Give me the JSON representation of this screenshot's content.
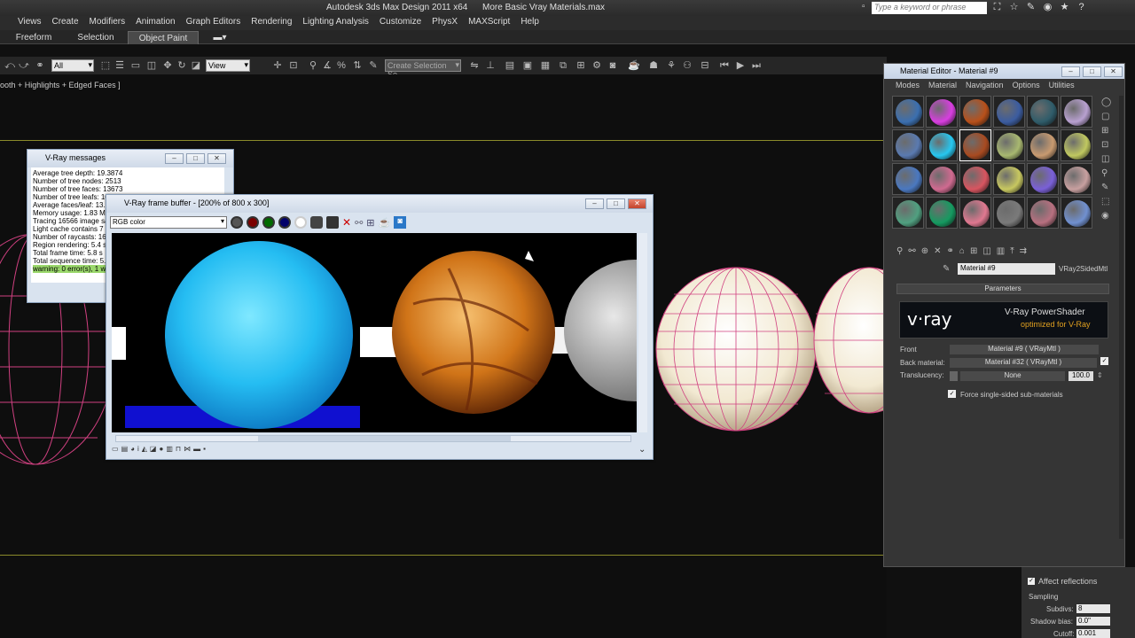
{
  "titlebar": {
    "app": "Autodesk 3ds Max Design 2011 x64",
    "file": "More Basic Vray Materials.max",
    "search_placeholder": "Type a keyword or phrase"
  },
  "menubar": [
    "Views",
    "Create",
    "Modifiers",
    "Animation",
    "Graph Editors",
    "Rendering",
    "Lighting Analysis",
    "Customize",
    "PhysX",
    "MAXScript",
    "Help"
  ],
  "ribbon": {
    "tabs": [
      "Freeform",
      "Selection",
      "Object Paint"
    ],
    "active": "Object Paint"
  },
  "toolbar": {
    "filter": "All",
    "coord": "View",
    "selection_set": "Create Selection Se"
  },
  "viewport": {
    "label": "ooth + Highlights + Edged Faces ]"
  },
  "vray_messages": {
    "title": "V-Ray messages",
    "lines": [
      "Average tree depth: 19.3874",
      "Number of tree nodes: 2513",
      "Number of tree faces: 13673",
      "Number of tree leafs: 10",
      "Average faces/leaf: 13.",
      "Memory usage: 1.83 MI",
      "Tracing 16566 image sa",
      "Light cache contains 7",
      "Number of raycasts: 16",
      "Region rendering: 5.4 s",
      "Total frame time: 5.8 s",
      "Total sequence time: 5.",
      "warning: 0 error(s), 1 wa"
    ]
  },
  "vfb": {
    "title": "V-Ray frame buffer - [200% of 800 x 300]",
    "channel": "RGB color"
  },
  "material_editor": {
    "title": "Material Editor - Material #9",
    "menu": [
      "Modes",
      "Material",
      "Navigation",
      "Options",
      "Utilities"
    ],
    "material_name": "Material #9",
    "material_type": "VRay2SidedMtl",
    "section": "Parameters",
    "banner_title": "V-Ray PowerShader",
    "banner_subtitle": "optimized for V-Ray",
    "banner_logo": "v·ray",
    "front_label": "Front",
    "front_value": "Material #9  ( VRayMtl )",
    "back_label": "Back material:",
    "back_value": "Material #32  ( VRayMtl )",
    "translucency_label": "Translucency:",
    "translucency_map": "None",
    "translucency_amount": "100.0",
    "force_label": "Force single-sided sub-materials",
    "slot_colors": [
      "#3b6fb0",
      "#d83ee0",
      "#b8501a",
      "#3b5ca0",
      "#2f5c6a",
      "#b8a0d0",
      "#5a7ab0",
      "#26c7f0",
      "#a84a20",
      "#a8b870",
      "#c89a70",
      "#c0c860",
      "#4a78c0",
      "#d06a90",
      "#d85560",
      "#c8c860",
      "#7a60d8",
      "#c8a0a0",
      "#50a080",
      "#159a60",
      "#e07890",
      "#7a7a7a",
      "#b87080",
      "#7090d0"
    ]
  },
  "command_panel": {
    "affect_reflections": "Affect reflections",
    "sampling": "Sampling",
    "subdivs_label": "Subdivs:",
    "subdivs_value": "8",
    "shadow_bias_label": "Shadow bias:",
    "shadow_bias_value": "0.0\"",
    "cutoff_label": "Cutoff:",
    "cutoff_value": "0.001"
  }
}
